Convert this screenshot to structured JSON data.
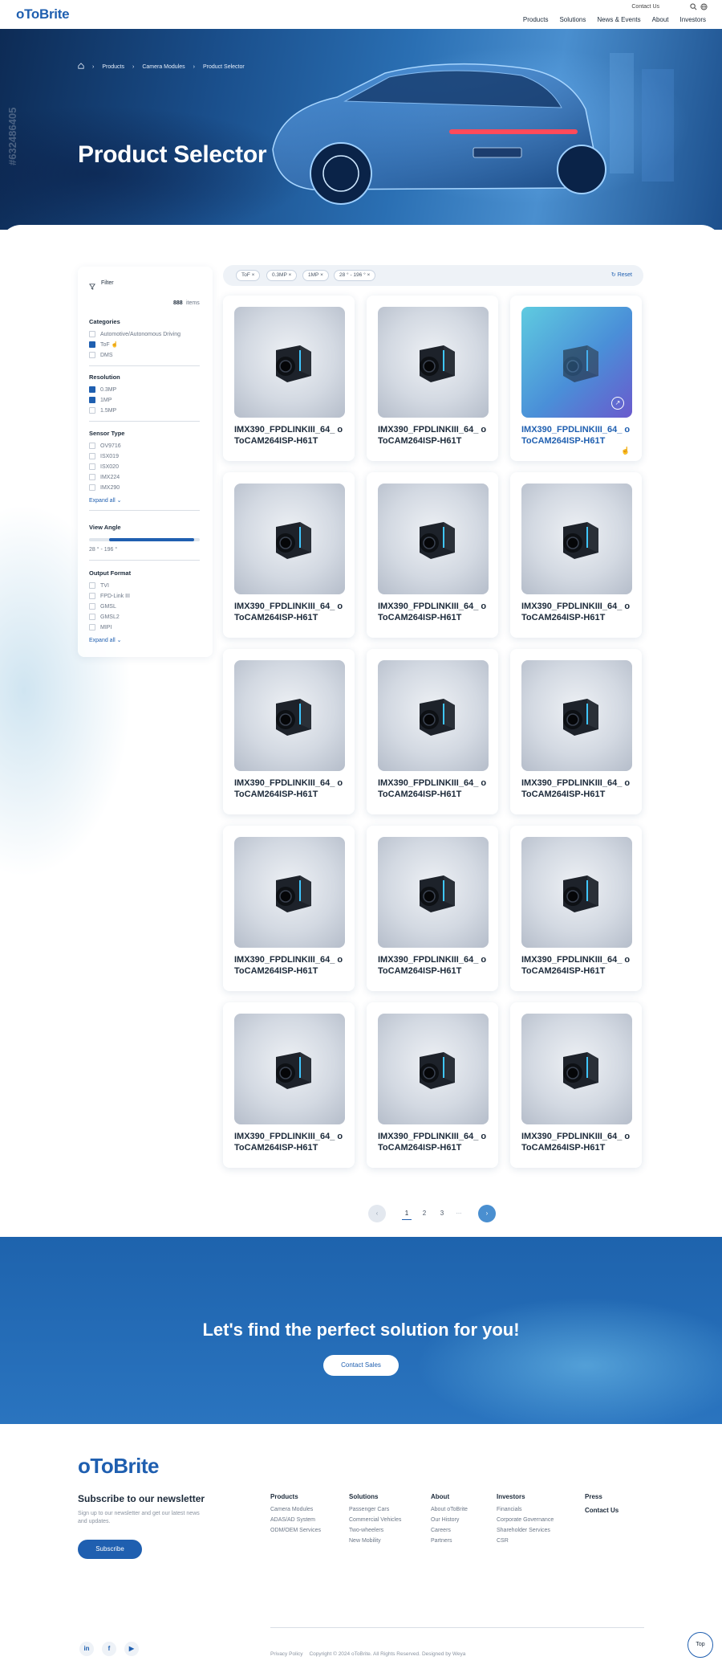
{
  "header": {
    "logo": "oToBrite",
    "contact_us": "Contact Us",
    "nav": [
      "Products",
      "Solutions",
      "News & Events",
      "About",
      "Investors"
    ]
  },
  "hero": {
    "breadcrumb": [
      "Products",
      "Camera Modules",
      "Product Selector"
    ],
    "title": "Product Selector",
    "watermark": "#632486405"
  },
  "filter": {
    "title": "Filter",
    "count": "888",
    "count_label": "items",
    "categories": {
      "label": "Categories",
      "options": [
        {
          "label": "Automotive/Autonomous Driving",
          "checked": false
        },
        {
          "label": "ToF",
          "checked": true
        },
        {
          "label": "DMS",
          "checked": false
        }
      ]
    },
    "resolution": {
      "label": "Resolution",
      "options": [
        {
          "label": "0.3MP",
          "checked": true
        },
        {
          "label": "1MP",
          "checked": true
        },
        {
          "label": "1.5MP",
          "checked": false
        }
      ]
    },
    "sensor": {
      "label": "Sensor Type",
      "options": [
        {
          "label": "OV9716",
          "checked": false
        },
        {
          "label": "ISX019",
          "checked": false
        },
        {
          "label": "ISX020",
          "checked": false
        },
        {
          "label": "IMX224",
          "checked": false
        },
        {
          "label": "IMX290",
          "checked": false
        }
      ],
      "expand": "Expand all"
    },
    "view_angle": {
      "label": "View Angle",
      "value": "28 ° - 196 °"
    },
    "output": {
      "label": "Output Format",
      "options": [
        {
          "label": "TVI",
          "checked": false
        },
        {
          "label": "FPD-Link III",
          "checked": false
        },
        {
          "label": "GMSL",
          "checked": false
        },
        {
          "label": "GMSL2",
          "checked": false
        },
        {
          "label": "MIPI",
          "checked": false
        }
      ],
      "expand": "Expand all"
    }
  },
  "chips": [
    "ToF",
    "0.3MP",
    "1MP",
    "28 ° - 196 °"
  ],
  "reset": "Reset",
  "product_title": "IMX390_FPDLINKIII_64_ oToCAM264ISP-H61T",
  "products": [
    "IMX390_FPDLINKIII_64_ oToCAM264ISP-H61T",
    "IMX390_FPDLINKIII_64_ oToCAM264ISP-H61T",
    "IMX390_FPDLINKIII_64_ oToCAM264ISP-H61T",
    "IMX390_FPDLINKIII_64_ oToCAM264ISP-H61T",
    "IMX390_FPDLINKIII_64_ oToCAM264ISP-H61T",
    "IMX390_FPDLINKIII_64_ oToCAM264ISP-H61T",
    "IMX390_FPDLINKIII_64_ oToCAM264ISP-H61T",
    "IMX390_FPDLINKIII_64_ oToCAM264ISP-H61T",
    "IMX390_FPDLINKIII_64_ oToCAM264ISP-H61T",
    "IMX390_FPDLINKIII_64_ oToCAM264ISP-H61T",
    "IMX390_FPDLINKIII_64_ oToCAM264ISP-H61T",
    "IMX390_FPDLINKIII_64_ oToCAM264ISP-H61T",
    "IMX390_FPDLINKIII_64_ oToCAM264ISP-H61T",
    "IMX390_FPDLINKIII_64_ oToCAM264ISP-H61T",
    "IMX390_FPDLINKIII_64_ oToCAM264ISP-H61T"
  ],
  "pagination": {
    "pages": [
      "1",
      "2",
      "3",
      "..."
    ],
    "current": "1"
  },
  "cta": {
    "title": "Let's find the perfect solution for you!",
    "button": "Contact Sales"
  },
  "footer": {
    "logo": "oToBrite",
    "newsletter_title": "Subscribe to our newsletter",
    "newsletter_desc": "Sign up to our newsletter and get our latest news and updates.",
    "subscribe": "Subscribe",
    "columns": [
      {
        "title": "Products",
        "items": [
          "Camera Modules",
          "ADAS/AD System",
          "ODM/OEM Services"
        ]
      },
      {
        "title": "Solutions",
        "items": [
          "Passenger Cars",
          "Commercial Vehicles",
          "Two-wheelers",
          "New Mobility"
        ]
      },
      {
        "title": "About",
        "items": [
          "About oToBrite",
          "Our History",
          "Careers",
          "Partners"
        ]
      },
      {
        "title": "Investors",
        "items": [
          "Financials",
          "Corporate Governance",
          "Shareholder Services",
          "CSR"
        ]
      },
      {
        "title": "Press",
        "items": []
      },
      {
        "title": "Contact Us",
        "items": []
      }
    ],
    "privacy": "Privacy Policy",
    "copyright": "Copyright © 2024 oToBrite. All Rights Reserved.",
    "designed": "Designed by Weya",
    "top": "Top",
    "social": [
      "in",
      "f",
      "▶"
    ]
  },
  "colors": {
    "brand": "#1f5fb0",
    "cta_bg": "#2a74bf"
  }
}
